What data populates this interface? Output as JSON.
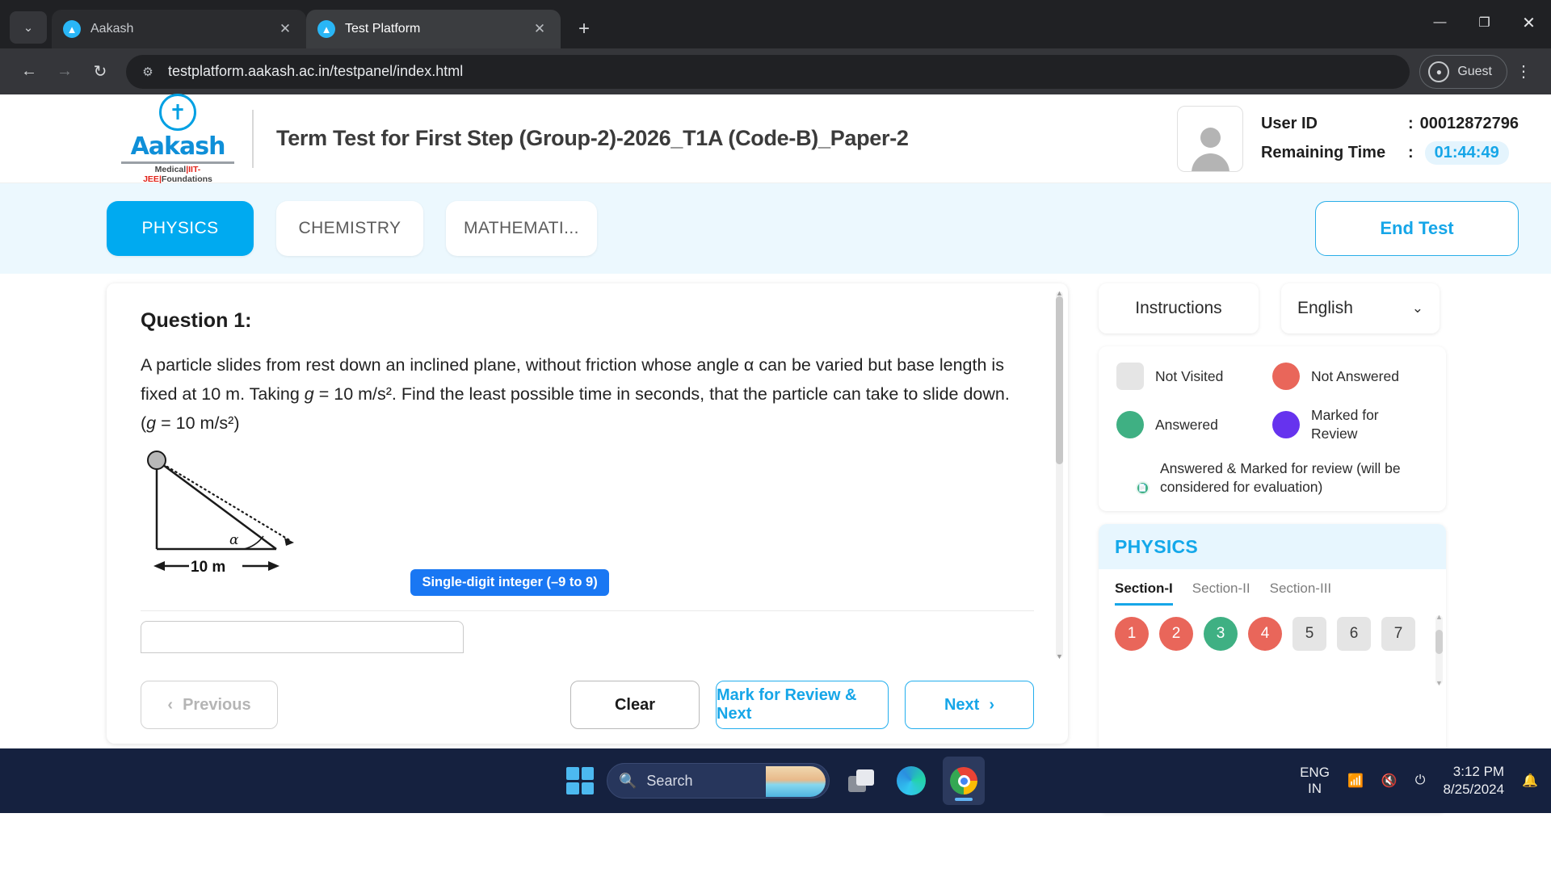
{
  "browser": {
    "tabs": [
      {
        "title": "Aakash",
        "favicon": "aakash-favicon",
        "active": false
      },
      {
        "title": "Test Platform",
        "favicon": "aakash-favicon",
        "active": true
      }
    ],
    "url": "testplatform.aakash.ac.in/testpanel/index.html",
    "profile_label": "Guest",
    "tab_close_glyph": "✕",
    "new_tab_glyph": "+",
    "back_glyph": "←",
    "forward_glyph": "→",
    "reload_glyph": "↻",
    "minimize_glyph": "—",
    "maximize_glyph": "❐",
    "close_glyph": "✕",
    "tab_list_glyph": "⌄",
    "kebab_glyph": "⋮"
  },
  "header": {
    "logo_word": "Aakash",
    "logo_sub_1": "Medical",
    "logo_sub_2": "IIT-JEE",
    "logo_sub_3": "Foundations",
    "test_title": "Term Test for First Step (Group-2)-2026_T1A (Code-B)_Paper-2",
    "user_id_label": "User ID",
    "user_id_value": "00012872796",
    "remaining_label": "Remaining Time",
    "remaining_value": "01:44:49",
    "colon": ":"
  },
  "subject_bar": {
    "tabs": [
      {
        "label": "PHYSICS",
        "active": true
      },
      {
        "label": "CHEMISTRY",
        "active": false
      },
      {
        "label": "MATHEMATI...",
        "active": false
      }
    ],
    "end_test_label": "End Test"
  },
  "question": {
    "title": "Question 1:",
    "line1": "A particle slides from rest down an inclined plane, without friction whose angle α can be varied but",
    "line2_a": "base length is fixed at 10 m. Taking ",
    "line2_g": "g",
    "line2_b": " = 10 m/s². Find the least possible time in seconds, that the",
    "line3_a": "particle can take to slide down. (",
    "line3_g": "g",
    "line3_b": " = 10 m/s²)",
    "diagram_base_label": "10 m",
    "diagram_angle_label": "α",
    "answer_type_badge": "Single-digit integer (–9 to 9)",
    "answer_value": ""
  },
  "actions": {
    "previous_label": "Previous",
    "previous_icon": "‹",
    "clear_label": "Clear",
    "mark_label": "Mark for Review & Next",
    "next_label": "Next",
    "next_icon": "›"
  },
  "right_panel": {
    "instructions_label": "Instructions",
    "language_value": "English",
    "chevron": "⌄",
    "legend": [
      {
        "label": "Not Visited",
        "shape": "square",
        "color": "#e5e5e5"
      },
      {
        "label": "Not Answered",
        "shape": "circle",
        "color": "#e9665a"
      },
      {
        "label": "Answered",
        "shape": "circle",
        "color": "#3fb083"
      },
      {
        "label": "Marked for Review",
        "shape": "circle",
        "color": "#6633ee"
      },
      {
        "label": "Answered & Marked for review (will be considered for evaluation)",
        "shape": "combo",
        "color": "#6633ee",
        "badge_color": "#3fb083"
      }
    ],
    "palette_subject": "PHYSICS",
    "sections": [
      {
        "label": "Section-I",
        "active": true
      },
      {
        "label": "Section-II",
        "active": false
      },
      {
        "label": "Section-III",
        "active": false
      }
    ],
    "question_numbers": [
      {
        "n": "1",
        "state": "not-answered"
      },
      {
        "n": "2",
        "state": "not-answered"
      },
      {
        "n": "3",
        "state": "answered"
      },
      {
        "n": "4",
        "state": "not-answered"
      },
      {
        "n": "5",
        "state": "not-visited"
      },
      {
        "n": "6",
        "state": "not-visited"
      },
      {
        "n": "7",
        "state": "not-visited"
      }
    ]
  },
  "taskbar": {
    "search_placeholder": "Search",
    "language": "ENG",
    "region": "IN",
    "time": "3:12 PM",
    "date": "8/25/2024",
    "wifi_glyph": "◠",
    "volume_glyph": "🔇",
    "battery_glyph": "▭",
    "bell_glyph": "🔔"
  },
  "colors": {
    "accent": "#00aaf0",
    "accent_dark": "#16a6e8",
    "answered": "#3fb083",
    "not_answered": "#e9665a",
    "marked": "#6633ee",
    "badge_blue": "#1977f3",
    "subject_bg": "#ecf8fe"
  }
}
